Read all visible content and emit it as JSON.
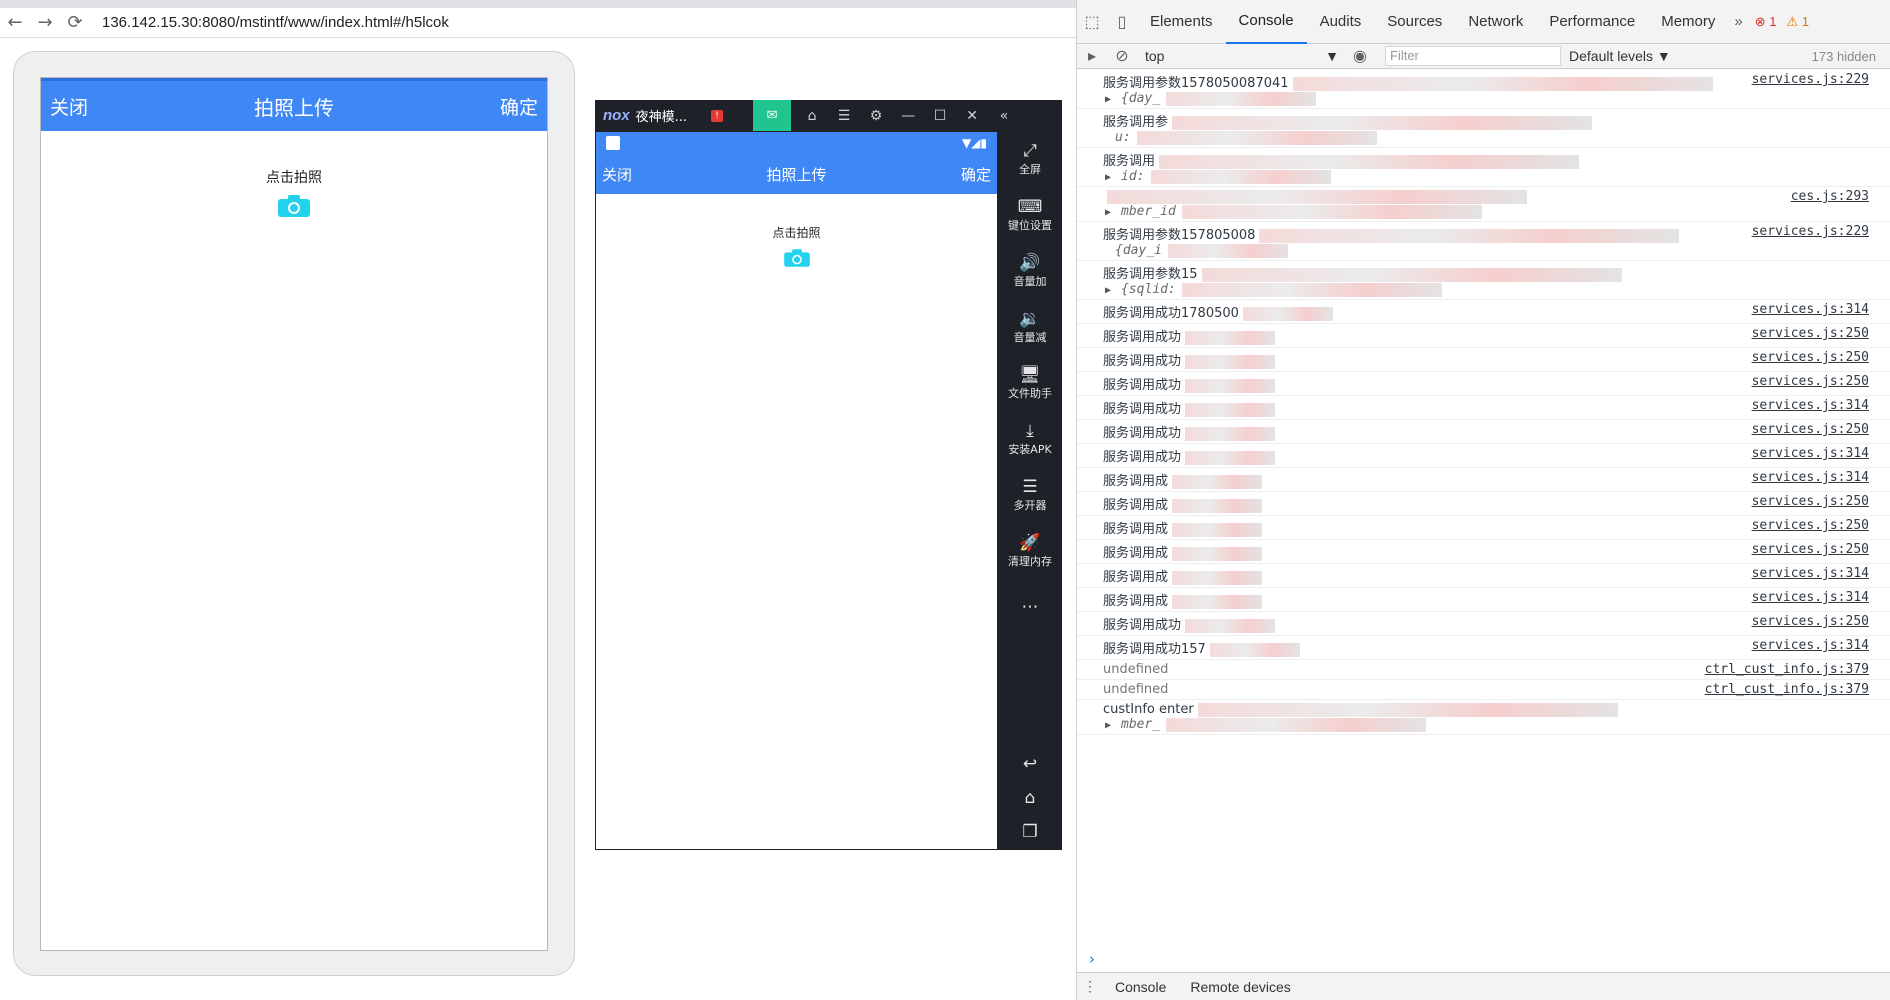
{
  "browser": {
    "url": "136.142.15.30:8080/mstintf/www/index.html#/h5lcok",
    "back_icon": "←",
    "forward_icon": "→",
    "reload_icon": "⟳"
  },
  "app": {
    "close_label": "关闭",
    "title": "拍照上传",
    "confirm_label": "确定",
    "hint": "点击拍照",
    "accent": "#3f87f5",
    "camera_color": "#22d3ee"
  },
  "emulator": {
    "logo": "nox",
    "name": "夜神模...",
    "close_label": "关闭",
    "title": "拍照上传",
    "confirm_label": "确定",
    "hint": "点击拍照",
    "side_items": [
      {
        "icon": "⤢",
        "label": "全屏"
      },
      {
        "icon": "⌨",
        "label": "键位设置"
      },
      {
        "icon": "🔊",
        "label": "音量加"
      },
      {
        "icon": "🔉",
        "label": "音量减"
      },
      {
        "icon": "🖥",
        "label": "文件助手"
      },
      {
        "icon": "⤓",
        "label": "安装APK"
      },
      {
        "icon": "☰",
        "label": "多开器"
      },
      {
        "icon": "🚀",
        "label": "清理内存"
      },
      {
        "icon": "⋯",
        "label": ""
      }
    ]
  },
  "devtools": {
    "tabs": [
      "Elements",
      "Console",
      "Audits",
      "Sources",
      "Network",
      "Performance",
      "Memory"
    ],
    "active_tab": "Console",
    "errors": "1",
    "warnings": "1",
    "context": "top",
    "filter_placeholder": "Filter",
    "levels": "Default levels ▼",
    "hidden": "173 hidden",
    "drawer_tabs": [
      "Console",
      "Remote devices"
    ],
    "logs": [
      {
        "msg": "服务调用参数1578050087041",
        "src": "services.js:229",
        "sub": "{day_",
        "expand": true
      },
      {
        "msg": "服务调用参",
        "src": "",
        "sub": "u:",
        "expand": false
      },
      {
        "msg": "服务调用",
        "src": "",
        "sub": "id:",
        "expand": true
      },
      {
        "msg": "",
        "src": "ces.js:293",
        "sub": "mber_id",
        "expand": true
      },
      {
        "msg": "服务调用参数157805008",
        "src": "services.js:229",
        "sub": "{day_i",
        "expand": false
      },
      {
        "msg": "服务调用参数15",
        "src": "",
        "sub": "{sqlid:",
        "expand": true
      },
      {
        "msg": "服务调用成功1780500",
        "src": "services.js:314"
      },
      {
        "msg": "服务调用成功",
        "src": "services.js:250"
      },
      {
        "msg": "服务调用成功",
        "src": "services.js:250"
      },
      {
        "msg": "服务调用成功",
        "src": "services.js:250"
      },
      {
        "msg": "服务调用成功",
        "src": "services.js:314"
      },
      {
        "msg": "服务调用成功",
        "src": "services.js:250"
      },
      {
        "msg": "服务调用成功",
        "src": "services.js:314"
      },
      {
        "msg": "服务调用成",
        "src": "services.js:314"
      },
      {
        "msg": "服务调用成",
        "src": "services.js:250"
      },
      {
        "msg": "服务调用成",
        "src": "services.js:250"
      },
      {
        "msg": "服务调用成",
        "src": "services.js:250"
      },
      {
        "msg": "服务调用成",
        "src": "services.js:314"
      },
      {
        "msg": "服务调用成",
        "src": "services.js:314"
      },
      {
        "msg": "服务调用成功",
        "src": "services.js:250"
      },
      {
        "msg": "服务调用成功157",
        "src": "services.js:314"
      },
      {
        "msg": "undefined",
        "src": "ctrl_cust_info.js:379",
        "undef": true
      },
      {
        "msg": "undefined",
        "src": "ctrl_cust_info.js:379",
        "undef": true
      },
      {
        "msg": "custInfo enter",
        "src": "",
        "sub": "mber_",
        "expand": true
      }
    ]
  }
}
